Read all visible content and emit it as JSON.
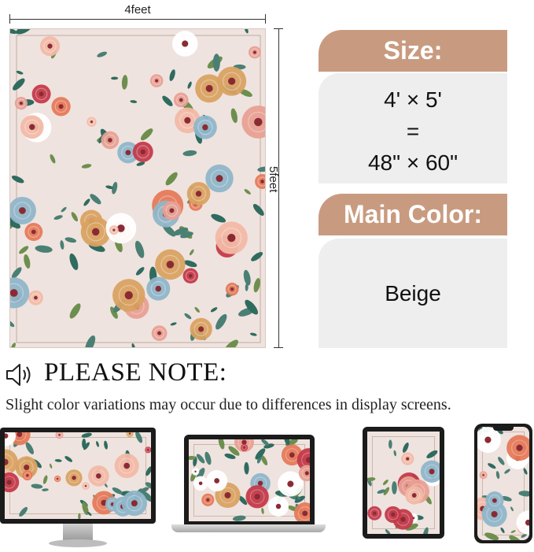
{
  "dimensions": {
    "width_label": "4feet",
    "height_label": "5feet"
  },
  "size_section": {
    "title": "Size:",
    "line1": "4' × 5'",
    "line2": "=",
    "line3": "48\" × 60\""
  },
  "color_section": {
    "title": "Main Color:",
    "value": "Beige"
  },
  "note": {
    "title": "PLEASE NOTE:",
    "text": "Slight color variations may occur due to differences in display screens."
  },
  "palette": {
    "rug_background": "#efe3df",
    "tab_color": "#c89b80",
    "panel_color": "#eeeeee",
    "flower_colors": [
      "#e8a093",
      "#c43a4a",
      "#f2b9a6",
      "#e57a5a",
      "#d9a262",
      "#8fb6c9",
      "#ffffff"
    ],
    "leaf_colors": [
      "#2f6b5e",
      "#6d8f4e",
      "#4a7f74"
    ]
  },
  "devices": [
    "monitor",
    "laptop",
    "tablet",
    "phone"
  ]
}
